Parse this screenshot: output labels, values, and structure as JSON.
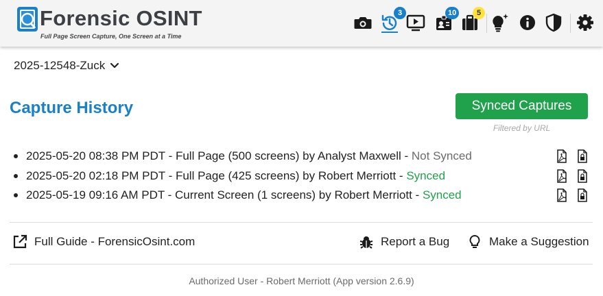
{
  "header": {
    "brand_name": "Forensic OSINT",
    "tagline": "Full Page Screen Capture, One Screen at a Time",
    "icons": [
      {
        "name": "camera-icon"
      },
      {
        "name": "history-icon",
        "badge": "3",
        "badge_color": "#1a7fc9"
      },
      {
        "name": "video-icon"
      },
      {
        "name": "id-badge-icon",
        "badge": "10",
        "badge_color": "#1a7fc9"
      },
      {
        "name": "briefcase-icon",
        "badge": "5",
        "badge_color": "#ffe23b"
      },
      {
        "name": "lightbulb-sparkle-icon"
      },
      {
        "name": "info-icon"
      },
      {
        "name": "shield-icon"
      },
      {
        "name": "gear-icon"
      }
    ]
  },
  "case_selector": {
    "value": "2025-12548-Zuck"
  },
  "history": {
    "title": "Capture History",
    "synced_button_label": "Synced Captures",
    "filter_note": "Filtered by URL",
    "captures": [
      {
        "text": "2025-05-20 08:38 PM PDT - Full Page (500 screens) by Analyst Maxwell - ",
        "status": "Not Synced"
      },
      {
        "text": "2025-05-20 02:18 PM PDT - Full Page (425 screens) by Robert Merriott - ",
        "status": "Synced"
      },
      {
        "text": "2025-05-19 09:16 AM PDT - Current Screen (1 screens) by Robert Merriott - ",
        "status": "Synced"
      }
    ]
  },
  "footer": {
    "guide_label": "Full Guide - ForensicOsint.com",
    "bug_label": "Report a Bug",
    "suggestion_label": "Make a Suggestion",
    "user_info": "Authorized User - Robert Merriott (App version 2.6.9)"
  },
  "colors": {
    "accent_blue": "#1a80c8",
    "synced_green": "#20a14b",
    "not_synced_gray": "#6b6b6b"
  }
}
